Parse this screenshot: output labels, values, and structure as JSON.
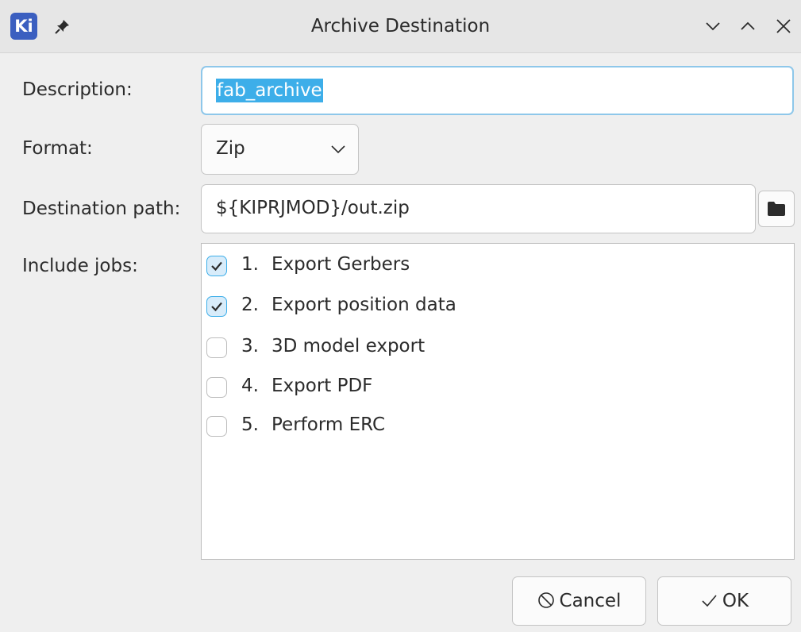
{
  "window": {
    "title": "Archive Destination",
    "app_logo_text": "Ki"
  },
  "form": {
    "description_label": "Description:",
    "description_value": "fab_archive",
    "format_label": "Format:",
    "format_value": "Zip",
    "destination_label": "Destination path:",
    "destination_value": "${KIPRJMOD}/out.zip",
    "jobs_label": "Include jobs:"
  },
  "jobs": [
    {
      "num": "1.",
      "label": "Export Gerbers",
      "checked": true
    },
    {
      "num": "2.",
      "label": "Export position data",
      "checked": true
    },
    {
      "num": "3.",
      "label": "3D model export",
      "checked": false
    },
    {
      "num": "4.",
      "label": "Export PDF",
      "checked": false
    },
    {
      "num": "5.",
      "label": "Perform ERC",
      "checked": false
    }
  ],
  "buttons": {
    "cancel": "Cancel",
    "ok": "OK"
  },
  "colors": {
    "accent": "#3daee9",
    "logo": "#3b5fc0"
  }
}
